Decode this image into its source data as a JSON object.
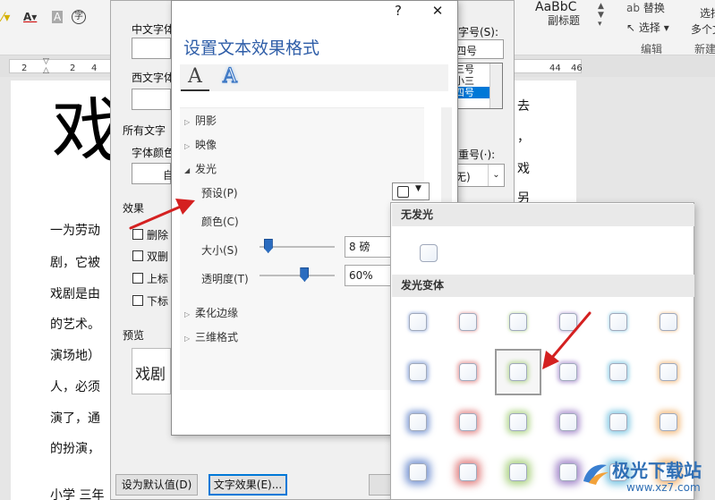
{
  "word": {
    "ribbon": {
      "style_preview": "AaBbC",
      "style_name": "副标题",
      "replace": "替换",
      "select": "选择",
      "editing_group": "编辑",
      "new_group": "新建",
      "select_trunc": "选择",
      "multi_trunc": "多个文"
    },
    "ruler_numbers": [
      "2",
      "2",
      "4",
      "44",
      "46"
    ],
    "doc": {
      "big_char": "戏",
      "lines": [
        "一为劳动",
        "剧，它被",
        "戏剧是由",
        "的艺术。",
        "演场地）",
        "人，必须",
        "演了，通",
        "的扮演，",
        "小学 三年"
      ],
      "right_chars": [
        "去",
        "，",
        "戏",
        "另"
      ]
    }
  },
  "font_dialog": {
    "cn_font_label": "中文字体",
    "west_font_label": "西文字体",
    "size_label": "字号(S):",
    "size_value": "四号",
    "size_list": [
      "三号",
      "小三",
      "四号"
    ],
    "all_text": "所有文字",
    "font_color_label": "字体颜色",
    "font_color_value": "自",
    "emphasis_label": "重号(·):",
    "emphasis_value": "无)",
    "effects_label": "效果",
    "effects": [
      "删除",
      "双删",
      "上标",
      "下标"
    ],
    "preview_label": "预览",
    "preview_text": "戏剧",
    "set_default": "设为默认值(D)",
    "text_effects": "文字效果(E)..."
  },
  "effect_pane": {
    "title": "设置文本效果格式",
    "help": "?",
    "close": "✕",
    "tabs": [
      "A",
      "A"
    ],
    "sections": {
      "shadow": "阴影",
      "reflection": "映像",
      "glow": "发光",
      "soft_edges": "柔化边缘",
      "format_3d": "三维格式"
    },
    "glow": {
      "preset_label": "预设(P)",
      "color_label": "颜色(C)",
      "size_label": "大小(S)",
      "size_value": "8 磅",
      "transparency_label": "透明度(T)",
      "transparency_value": "60%",
      "size_fraction": 0.08,
      "transparency_fraction": 0.6
    }
  },
  "glow_gallery": {
    "no_glow": "无发光",
    "glow_variations": "发光变体",
    "colors": [
      "#6f8fd0",
      "#e07a7a",
      "#a6cf7a",
      "#9d7fc7",
      "#6fc0e0",
      "#f0b06a"
    ],
    "selected_row": 1,
    "selected_col": 2
  },
  "watermark": {
    "name": "极光下载站",
    "url": "www.xz7.com"
  }
}
